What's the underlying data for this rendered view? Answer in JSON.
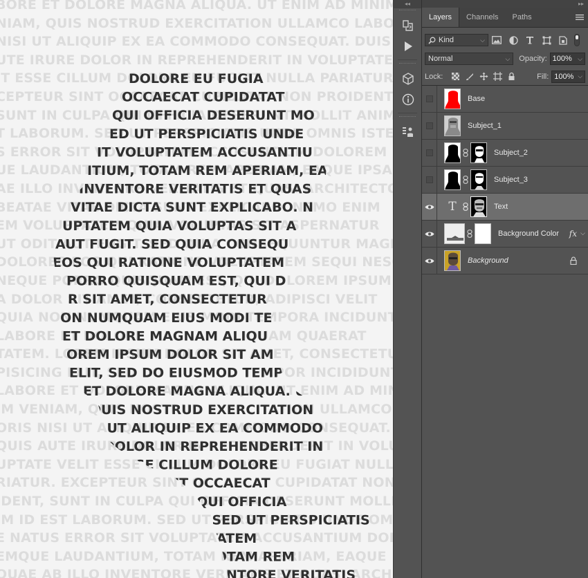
{
  "canvas": {
    "background_lines": [
      "BORE ET DOLORE MAGNA ALIQUA. UT ENIM AD MINIM",
      "NIAM, QUIS NOSTRUD EXERCITATION ULLAMCO LABO",
      "NISI UT ALIQUIP EX EA COMMODO CONSEQUAT. DUIS",
      "UTE IRURE DOLOR IN REPREHENDERIT IN VOLUPTATE",
      "IT ESSE CILLUM DOLORE EU FUGIAT NULLA PARIATUR",
      "CEPTEUR SINT OCCAECAT CUPIDATAT NON PROIDENT",
      "SUNT IN CULPA QUI OFFICIA DESERUNT MOLLIT ANIM",
      "T LABORUM. SED UT PERSPICIATIS UNDE OMNIS ISTE",
      "S ERROR SIT VOLUPTATEM ACCUSANTIUM DOLOREM",
      "UE LAUDANTIUM, TOTAM REM APERIAM, EAQUE IPSA",
      "AE ILLO INVENTORE VERITATIS ET QUASI ARCHITECTO",
      "BEATAE VITAE DICTA SUNT EXPLICABO. NEMO ENIM",
      "EM VOLUPTATEM QUIA VOLUPTAS SIT ASPERNATUR",
      "UT ODIT AUT FUGIT. SED QUIA CONSEQUUNTUR MAGNI",
      "DOLORES EOS QUI RATIONE VOLUPTATEM SEQUI NESCI",
      "NEQUE PORRO QUISQUAM EST, QUI DOLOREM IPSUM",
      "A DOLOR SIT AMET, CONSECTETUR, ADIPISCI VELIT",
      "QUIA NON NUMQUAM EIUS MODI TEMPORA INCIDUNT",
      "LABORE ET DOLORE MAGNAM ALIQUAM QUAERAT",
      "TATEM. LOREM IPSUM DOLOR SIT AMET, CONSECTETUR",
      "PISICING ELIT, SED DO EIUSMOD TEMPOR INCIDIDUNT",
      "LABORE ET DOLORE MAGNA ALIQUA. UT ENIM AD MIN",
      "IM VENIAM, QUIS NOSTRUD EXERCITATION ULLAMCO",
      "ORIS NISI UT ALIQUIP EX EA COMMODO CONSEQUAT.",
      "QUIS AUTE IRURE DOLOR IN REPREHENDERIT IN VOLU",
      "UPTATE VELIT ESSE CILLUM DOLORE EU FUGIAT NULLA",
      "RIATUR. EXCEPTEUR SINT OCCAECAT CUPIDATAT NON",
      "IDENT, SUNT IN CULPA QUI OFFICIA DESERUNT MOLLIT",
      "IM ID EST LABORUM. SED UT PERSPICIATIS UNDE OMNIS",
      "E NATUS ERROR SIT VOLUPTATEM ACCUSANTIUM DOLO",
      "EMQUE LAUDANTIUM, TOTAM REM APERIAM, EAQUE",
      "QUAE AB ILLO INVENTORE VERITATIS ET QUASI ARCH"
    ],
    "portrait_lines": [
      "DOLORE EU FUGIA",
      "OCCAECAT CUPIDATAT",
      "QUI OFFICIA DESERUNT MO",
      "ED UT PERSPICIATIS UNDE",
      "IT VOLUPTATEM ACCUSANTIU",
      "ITIUM, TOTAM REM APERIAM, EA",
      "INVENTORE VERITATIS ET QUAS",
      "VITAE DICTA SUNT EXPLICABO. N",
      "UPTATEM QUIA VOLUPTAS SIT A",
      "AUT FUGIT. SED QUIA CONSEQU",
      "EOS QUI RATIONE VOLUPTATEM",
      "PORRO QUISQUAM EST, QUI D",
      "R SIT AMET, CONSECTETUR",
      "ION NUMQUAM EIUS MODI TE",
      "ET DOLORE MAGNAM ALIQU",
      "OREM IPSUM DOLOR SIT AM",
      "ELIT, SED DO EIUSMOD TEMPO",
      "ET DOLORE MAGNA ALIQUA. UT",
      "QUIS NOSTRUD EXERCITATION",
      "ISI UT ALIQUIP EX EA COMMODO",
      "DOLOR IN REPREHENDERIT IN",
      "ESSE CILLUM DOLORE",
      "TEUR SINT OCCAECAT",
      "T IN CULPA QUI OFFICIA",
      "EST LABORUM. SED UT PERSPICIATIS",
      "S ERROR SIT VOLUPTATEM",
      "ANTIUM, TOTAM REM",
      "LLO INVENTORE VERITATIS"
    ]
  },
  "panel": {
    "tabs": [
      {
        "label": "Layers",
        "active": true
      },
      {
        "label": "Channels",
        "active": false
      },
      {
        "label": "Paths",
        "active": false
      }
    ],
    "filter": {
      "kind_label": "Kind"
    },
    "blend_mode": "Normal",
    "opacity_label": "Opacity:",
    "opacity_value": "100%",
    "lock_label": "Lock:",
    "fill_label": "Fill:",
    "fill_value": "100%",
    "layers": [
      {
        "name": "Base",
        "visible": false,
        "selected": false
      },
      {
        "name": "Subject_1",
        "visible": false,
        "selected": false
      },
      {
        "name": "Subject_2",
        "visible": false,
        "selected": false
      },
      {
        "name": "Subject_3",
        "visible": false,
        "selected": false
      },
      {
        "name": "Text",
        "visible": true,
        "selected": true
      },
      {
        "name": "Background Color",
        "visible": true,
        "selected": false,
        "fx": "fx"
      },
      {
        "name": "Background",
        "visible": true,
        "selected": false,
        "locked": true
      }
    ]
  },
  "colors": {
    "panel_bg": "#535353",
    "selected_row": "#6e6e6e",
    "base_red": "#ff0000"
  }
}
